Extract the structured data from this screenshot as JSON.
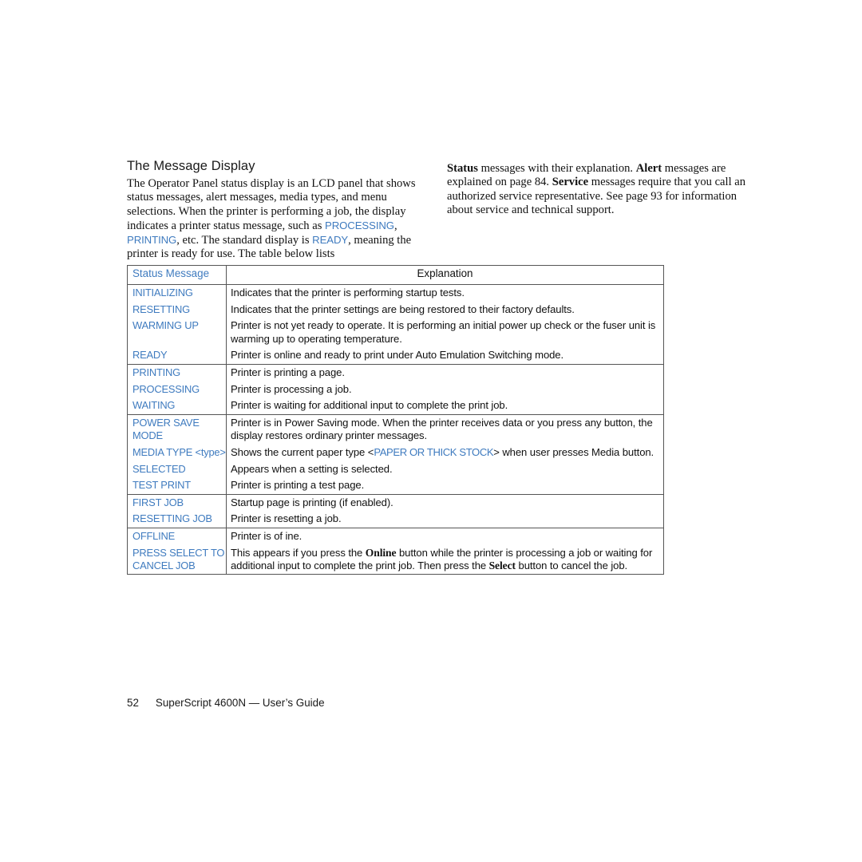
{
  "page": {
    "heading": "The Message Display",
    "footer": {
      "page_number": "52",
      "doc_title": "SuperScript 4600N  — User’s Guide"
    }
  },
  "colors": {
    "lcd_blue": "#3f7bbf",
    "text_black": "#111111",
    "table_border": "#555555",
    "background": "#ffffff"
  },
  "intro": {
    "left_column": {
      "part1": "The Operator Panel status display is an LCD panel that shows status messages, alert messages, media types, and menu selections. When the printer is performing a job, the display indicates a printer status message, such as ",
      "lcd1": "PROCESSING",
      "sep1": ", ",
      "lcd2": "PRINTING",
      "part2": ", etc. The standard display is ",
      "lcd3": "READY",
      "part3": ", meaning the printer is ready for use. The table below lists"
    },
    "right_column": {
      "b1": "Status",
      "t1": " messages with their explanation. ",
      "b2": "Alert",
      "t2": " messages are explained on page 84. ",
      "b3": "Service",
      "t3": " messages require that you call an authorized service representative. See page 93 for information about service and technical support."
    }
  },
  "table": {
    "headers": {
      "status_message": "Status Message",
      "explanation": "Explanation"
    },
    "groups": [
      {
        "rows": [
          {
            "message": "INITIALIZING",
            "explanation": "Indicates that the printer is performing startup tests."
          },
          {
            "message": "RESETTING",
            "explanation": "Indicates that the printer settings are being restored to their factory defaults."
          },
          {
            "message": "WARMING UP",
            "explanation": "Printer is not yet ready to operate. It is performing an initial power up check or the fuser unit is warming up to operating temperature."
          },
          {
            "message": "READY",
            "explanation": "Printer is online and ready to print under Auto Emulation Switching mode."
          }
        ]
      },
      {
        "rows": [
          {
            "message": "PRINTING",
            "explanation": "Printer is printing a page."
          },
          {
            "message": "PROCESSING",
            "explanation": "Printer is processing a job."
          },
          {
            "message": "WAITING",
            "explanation": "Printer is waiting for additional input to complete the print job."
          }
        ]
      },
      {
        "rows": [
          {
            "message": "POWER SAVE MODE",
            "explanation": "Printer is in Power Saving mode. When the printer receives data or you press any button, the display restores ordinary printer messages."
          },
          {
            "message": "MEDIA TYPE <type>",
            "explanation_pre": "Shows the current paper type <",
            "explanation_lcd": "PAPER OR THICK STOCK",
            "explanation_post": "> when user presses Media button."
          },
          {
            "message": "SELECTED",
            "explanation": "Appears when a setting is selected."
          },
          {
            "message": "TEST PRINT",
            "explanation": "Printer is printing a test page."
          }
        ]
      },
      {
        "rows": [
          {
            "message": "FIRST JOB",
            "explanation": "Startup page is printing (if enabled)."
          },
          {
            "message": "RESETTING JOB",
            "explanation": "Printer is resetting a job."
          }
        ]
      },
      {
        "rows": [
          {
            "message": "OFFLINE",
            "explanation": "Printer is of ine."
          },
          {
            "message": "PRESS SELECT TO CANCEL JOB",
            "explanation_pre": "This appears if you press the ",
            "explanation_b1": "Online",
            "explanation_mid": " button while the printer is processing a job or waiting for additional input to complete the print job. Then press the ",
            "explanation_b2": "Select",
            "explanation_post": " button to cancel the job."
          }
        ]
      }
    ]
  }
}
